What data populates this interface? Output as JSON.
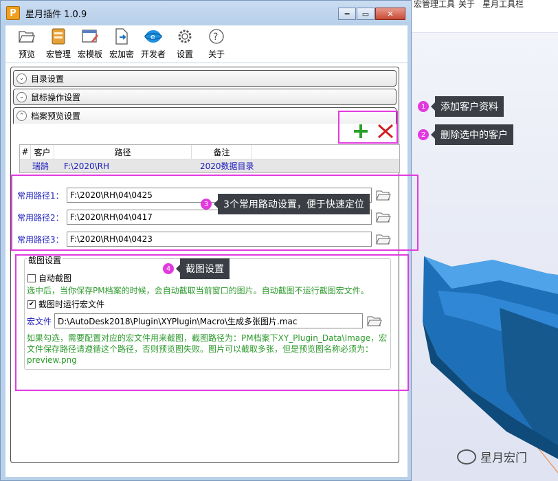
{
  "window": {
    "title": "星月插件 1.0.9",
    "icon_letter": "P",
    "min": "━",
    "max": "▭",
    "close": "✕"
  },
  "toolbar": [
    "预览",
    "宏管理",
    "宏模板",
    "宏加密",
    "开发者",
    "设置",
    "关于"
  ],
  "background_menu": [
    "宏管理工具",
    "关于",
    "星月工具栏"
  ],
  "sections": {
    "dir": "目录设置",
    "mouse": "鼠标操作设置",
    "preview": "档案预览设置"
  },
  "table": {
    "headers": [
      "#",
      "客户",
      "路径",
      "备注"
    ],
    "rows": [
      {
        "customer": "瑞鹄",
        "path": "F:\\2020\\RH",
        "note": "2020数据目录"
      }
    ]
  },
  "paths": [
    {
      "label": "常用路径1：",
      "value": "F:\\2020\\RH\\04\\0425"
    },
    {
      "label": "常用路径2：",
      "value": "F:\\2020\\RH\\04\\0417"
    },
    {
      "label": "常用路径3：",
      "value": "F:\\2020\\RH\\04\\0423"
    }
  ],
  "screenshot": {
    "legend": "截图设置",
    "auto_label": "自动截图",
    "auto_checked": false,
    "auto_desc": "选中后，当你保存PM档案的时候，会自动截取当前窗口的图片。自动截图不运行截图宏文件。",
    "run_label": "截图时运行宏文件",
    "run_checked": true,
    "macro_label": "宏文件",
    "macro_value": "D:\\AutoDesk2018\\Plugin\\XYPlugin\\Macro\\生成多张图片.mac",
    "desc_lines": [
      "如果勾选，需要配置对应的宏文件用来截图，截图路径为：PM档案下XY_Plugin_Data\\Image，宏",
      "文件保存路径请遵循这个路径，否则预览图失败。图片可以截取多张，但是预览图名称必须为：",
      "preview.png"
    ]
  },
  "annotations": [
    {
      "num": "1",
      "text": "添加客户资料"
    },
    {
      "num": "2",
      "text": "删除选中的客户"
    },
    {
      "num": "3",
      "text": "3个常用路动设置，便于快速定位"
    },
    {
      "num": "4",
      "text": "截图设置"
    }
  ],
  "watermark": "星月宏门",
  "colors": {
    "highlight": "#e23adf",
    "link_blue": "#1b1bbd",
    "green_text": "#2e9a2e",
    "add": "#2aa02a",
    "delete": "#d21f1f"
  },
  "icons": [
    "folder-open-icon",
    "macro-manager-icon",
    "macro-template-icon",
    "macro-encrypt-icon",
    "developer-icon",
    "settings-gear-icon",
    "about-question-icon"
  ]
}
